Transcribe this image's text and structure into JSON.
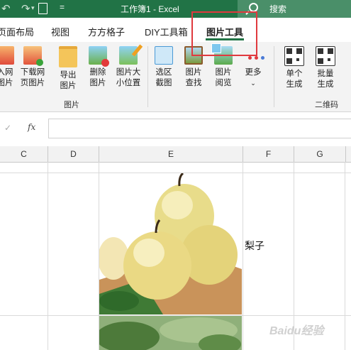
{
  "titlebar": {
    "doc_title": "工作簿1  -  Excel",
    "search_label": "搜索",
    "qat_more": "="
  },
  "tabs": [
    {
      "label": "页面布局"
    },
    {
      "label": "视图"
    },
    {
      "label": "方方格子"
    },
    {
      "label": "DIY工具箱"
    },
    {
      "label": "图片工具"
    }
  ],
  "ribbon": {
    "buttons": [
      {
        "label": "入网\n图片",
        "icon": "insert-web-image-icon"
      },
      {
        "label": "下载网\n页图片",
        "icon": "download-web-image-icon"
      },
      {
        "label": "导出\n图片",
        "icon": "export-image-icon"
      },
      {
        "label": "删除\n图片",
        "icon": "delete-image-icon"
      },
      {
        "label": "图片大\n小位置",
        "icon": "image-size-icon"
      },
      {
        "label": "选区\n截图",
        "icon": "selection-screenshot-icon"
      },
      {
        "label": "图片\n查找",
        "icon": "image-find-icon"
      },
      {
        "label": "图片\n阅览",
        "icon": "image-browse-icon"
      },
      {
        "label": "更多",
        "icon": "more-icon"
      },
      {
        "label": "单个\n生成",
        "icon": "qr-single-icon"
      },
      {
        "label": "批量\n生成",
        "icon": "qr-batch-icon"
      }
    ],
    "group_image": "图片",
    "group_qr": "二维码"
  },
  "formula": {
    "cancel": "✓",
    "fx": "fx"
  },
  "columns": [
    "C",
    "D",
    "E",
    "F",
    "G"
  ],
  "cell_text": "梨子",
  "watermark": "Baidu经验",
  "colors": {
    "excel_green": "#217346",
    "highlight_red": "#e0393e"
  }
}
